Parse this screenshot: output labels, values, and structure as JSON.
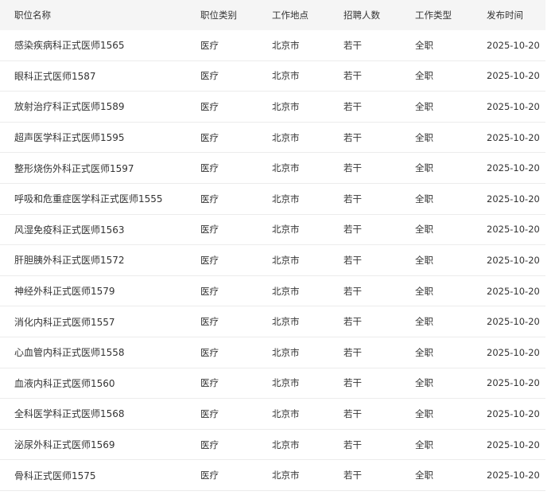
{
  "header": {
    "name": "职位名称",
    "category": "职位类别",
    "location": "工作地点",
    "count": "招聘人数",
    "type": "工作类型",
    "date": "发布时间"
  },
  "rows": [
    {
      "name": "感染疾病科正式医师1565",
      "category": "医疗",
      "location": "北京市",
      "count": "若干",
      "type": "全职",
      "date": "2025-10-20"
    },
    {
      "name": "眼科正式医师1587",
      "category": "医疗",
      "location": "北京市",
      "count": "若干",
      "type": "全职",
      "date": "2025-10-20"
    },
    {
      "name": "放射治疗科正式医师1589",
      "category": "医疗",
      "location": "北京市",
      "count": "若干",
      "type": "全职",
      "date": "2025-10-20"
    },
    {
      "name": "超声医学科正式医师1595",
      "category": "医疗",
      "location": "北京市",
      "count": "若干",
      "type": "全职",
      "date": "2025-10-20"
    },
    {
      "name": "整形烧伤外科正式医师1597",
      "category": "医疗",
      "location": "北京市",
      "count": "若干",
      "type": "全职",
      "date": "2025-10-20"
    },
    {
      "name": "呼吸和危重症医学科正式医师1555",
      "category": "医疗",
      "location": "北京市",
      "count": "若干",
      "type": "全职",
      "date": "2025-10-20"
    },
    {
      "name": "风湿免疫科正式医师1563",
      "category": "医疗",
      "location": "北京市",
      "count": "若干",
      "type": "全职",
      "date": "2025-10-20"
    },
    {
      "name": "肝胆胰外科正式医师1572",
      "category": "医疗",
      "location": "北京市",
      "count": "若干",
      "type": "全职",
      "date": "2025-10-20"
    },
    {
      "name": "神经外科正式医师1579",
      "category": "医疗",
      "location": "北京市",
      "count": "若干",
      "type": "全职",
      "date": "2025-10-20"
    },
    {
      "name": "消化内科正式医师1557",
      "category": "医疗",
      "location": "北京市",
      "count": "若干",
      "type": "全职",
      "date": "2025-10-20"
    },
    {
      "name": "心血管内科正式医师1558",
      "category": "医疗",
      "location": "北京市",
      "count": "若干",
      "type": "全职",
      "date": "2025-10-20"
    },
    {
      "name": "血液内科正式医师1560",
      "category": "医疗",
      "location": "北京市",
      "count": "若干",
      "type": "全职",
      "date": "2025-10-20"
    },
    {
      "name": "全科医学科正式医师1568",
      "category": "医疗",
      "location": "北京市",
      "count": "若干",
      "type": "全职",
      "date": "2025-10-20"
    },
    {
      "name": "泌尿外科正式医师1569",
      "category": "医疗",
      "location": "北京市",
      "count": "若干",
      "type": "全职",
      "date": "2025-10-20"
    },
    {
      "name": "骨科正式医师1575",
      "category": "医疗",
      "location": "北京市",
      "count": "若干",
      "type": "全职",
      "date": "2025-10-20"
    }
  ]
}
